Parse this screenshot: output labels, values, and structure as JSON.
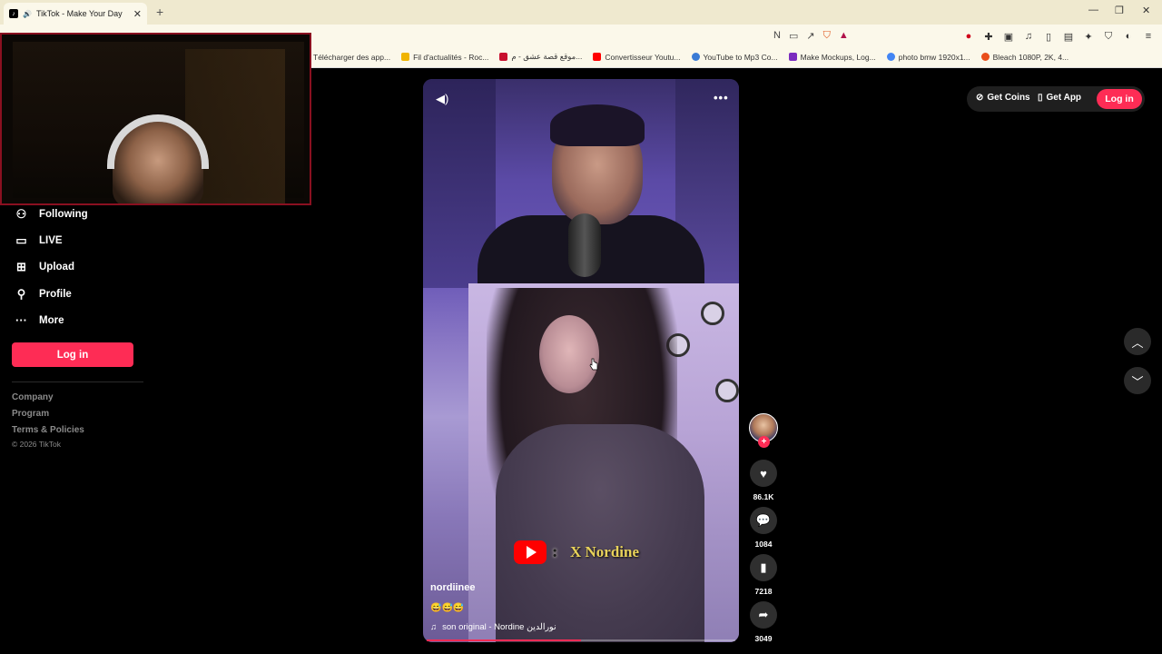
{
  "browser": {
    "tab_title": "TikTok - Make Your Day",
    "tab_favicon": "tiktok-icon",
    "new_tab_label": "+",
    "window_controls": [
      "—",
      "❐",
      "✕"
    ],
    "bookmarks": [
      {
        "label": "Télécharger des app...",
        "color": "#ffffff"
      },
      {
        "label": "Fil d'actualités - Roc...",
        "color": "#f0b400"
      },
      {
        "label": "موقع قصة عشق - م...",
        "color": "#c8102e"
      },
      {
        "label": "Convertisseur Youtu...",
        "color": "#ff0000"
      },
      {
        "label": "YouTube to Mp3 Co...",
        "color": "#3a7bd5"
      },
      {
        "label": "Make Mockups, Log...",
        "color": "#7b2cbf"
      },
      {
        "label": "photo bmw 1920x1...",
        "color": "#4285f4"
      },
      {
        "label": "Bleach 1080P, 2K, 4...",
        "color": "#e94e1b"
      }
    ]
  },
  "sidebar": {
    "items": [
      {
        "label": "Following",
        "icon": "following-icon"
      },
      {
        "label": "LIVE",
        "icon": "live-icon"
      },
      {
        "label": "Upload",
        "icon": "upload-icon"
      },
      {
        "label": "Profile",
        "icon": "profile-icon"
      },
      {
        "label": "More",
        "icon": "more-icon"
      }
    ],
    "login_label": "Log in",
    "footer_links": [
      "Company",
      "Program",
      "Terms & Policies"
    ],
    "copyright": "© 2026 TikTok"
  },
  "video": {
    "username": "nordiinee",
    "caption": "😅😅😅",
    "music": "son original - Nordine نورالدين",
    "overlay_colon": ":",
    "overlay_channel": "X Nordine",
    "progress": 0.5
  },
  "actions": {
    "likes": "86.1K",
    "comments": "1084",
    "saves": "7218",
    "shares": "3049"
  },
  "header": {
    "get_coins": "Get Coins",
    "get_app": "Get App",
    "login": "Log in"
  },
  "colors": {
    "accent": "#fe2c55",
    "background": "#000000"
  }
}
